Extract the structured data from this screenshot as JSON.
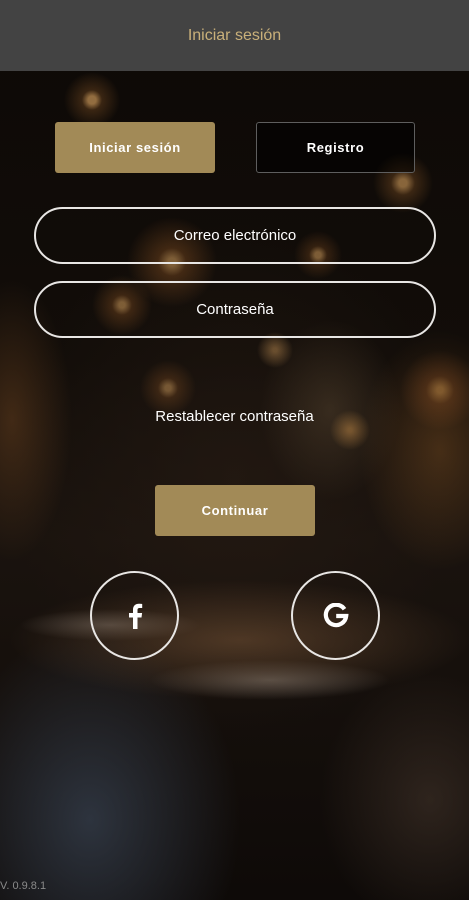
{
  "header": {
    "title": "Iniciar sesión"
  },
  "tabs": {
    "login_label": "Iniciar sesión",
    "register_label": "Registro"
  },
  "form": {
    "email_placeholder": "Correo electrónico",
    "password_placeholder": "Contraseña",
    "reset_password_label": "Restablecer contraseña",
    "continue_label": "Continuar"
  },
  "social": {
    "facebook_icon": "facebook-icon",
    "google_icon": "google-icon"
  },
  "footer": {
    "version": "V. 0.9.8.1"
  },
  "colors": {
    "accent_gold": "#a28a57",
    "header_bg": "#434343",
    "header_text": "#c9b07a",
    "text": "#ffffff"
  }
}
